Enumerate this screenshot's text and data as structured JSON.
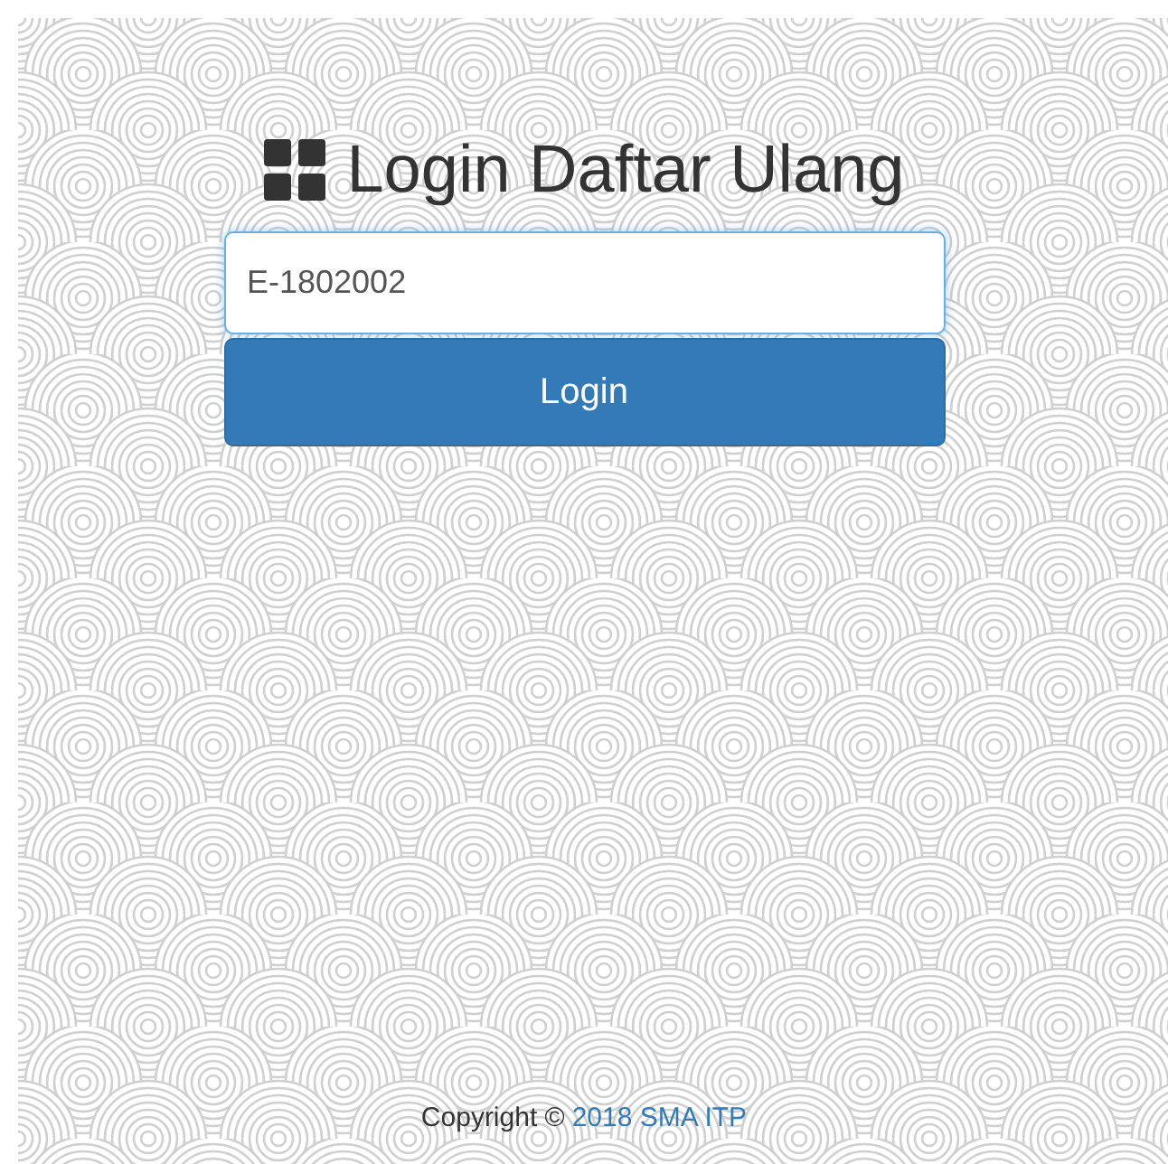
{
  "title": "Login Daftar Ulang",
  "input": {
    "value": "E-1802002"
  },
  "button": {
    "label": "Login"
  },
  "footer": {
    "text": "Copyright ©",
    "link": "2018 SMA ITP"
  }
}
